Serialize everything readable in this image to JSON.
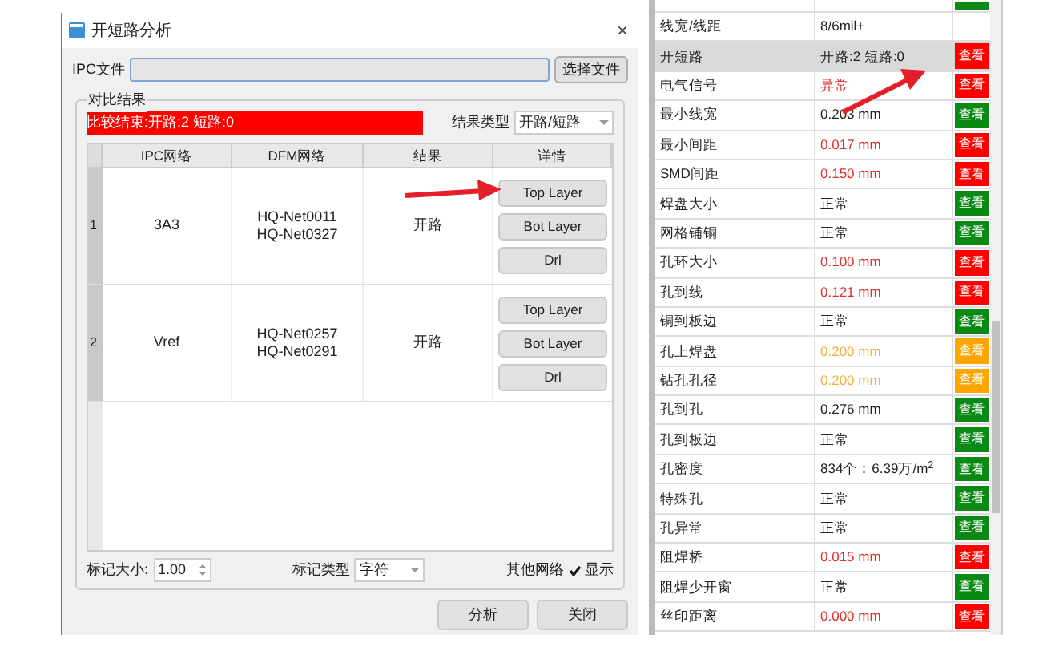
{
  "dialog": {
    "title": "开短路分析",
    "close": "×",
    "ipc_label": "IPC文件",
    "choose_button": "选择文件",
    "group_title": "对比结果",
    "summary": "比较结束:开路:2 短路:0",
    "result_type_label": "结果类型",
    "result_type_value": "开路/短路",
    "table": {
      "columns": [
        "IPC网络",
        "DFM网络",
        "结果",
        "详情"
      ],
      "rows": [
        {
          "index": "1",
          "ipc_net": "3A3",
          "dfm_nets": [
            "HQ-Net0011",
            "HQ-Net0327"
          ],
          "result": "开路",
          "buttons": [
            "Top Layer",
            "Bot Layer",
            "Drl"
          ]
        },
        {
          "index": "2",
          "ipc_net": "Vref",
          "dfm_nets": [
            "HQ-Net0257",
            "HQ-Net0291"
          ],
          "result": "开路",
          "buttons": [
            "Top Layer",
            "Bot Layer",
            "Drl"
          ]
        }
      ]
    },
    "mark_size_label": "标记大小:",
    "mark_size_value": "1.00",
    "mark_type_label": "标记类型",
    "mark_type_value": "字符",
    "other_nets_label": "其他网络",
    "show_label": "显示",
    "checked": true,
    "buttons": [
      "分析",
      "关闭"
    ]
  },
  "checks": [
    {
      "kind": "ok",
      "selected": false
    },
    {
      "label": "线宽/线距",
      "value": "8/6mil+",
      "alert": false,
      "warning": false,
      "kind": "plain",
      "selected": false
    },
    {
      "label": "开短路",
      "value": "开路:2 短路:0",
      "alert": false,
      "warning": false,
      "kind": "error",
      "button": "查看",
      "selected": true
    },
    {
      "label": "电气信号",
      "value": "异常",
      "alert": true,
      "warning": false,
      "kind": "error",
      "button": "查看",
      "selected": false
    },
    {
      "label": "最小线宽",
      "value": "0.203 mm",
      "alert": false,
      "warning": false,
      "kind": "ok",
      "button": "查看",
      "selected": false
    },
    {
      "label": "最小间距",
      "value": "0.017 mm",
      "alert": true,
      "warning": false,
      "kind": "error",
      "button": "查看",
      "selected": false
    },
    {
      "label": "SMD间距",
      "value": "0.150 mm",
      "alert": true,
      "warning": false,
      "kind": "error",
      "button": "查看",
      "selected": false
    },
    {
      "label": "焊盘大小",
      "value": "正常",
      "alert": false,
      "warning": false,
      "kind": "ok",
      "button": "查看",
      "selected": false
    },
    {
      "label": "网格铺铜",
      "value": "正常",
      "alert": false,
      "warning": false,
      "kind": "ok",
      "button": "查看",
      "selected": false
    },
    {
      "label": "孔环大小",
      "value": "0.100 mm",
      "alert": true,
      "warning": false,
      "kind": "error",
      "button": "查看",
      "selected": false
    },
    {
      "label": "孔到线",
      "value": "0.121 mm",
      "alert": true,
      "warning": false,
      "kind": "error",
      "button": "查看",
      "selected": false
    },
    {
      "label": "铜到板边",
      "value": "正常",
      "alert": false,
      "warning": false,
      "kind": "ok",
      "button": "查看",
      "selected": false
    },
    {
      "label": "孔上焊盘",
      "value": "0.200 mm",
      "alert": false,
      "warning": true,
      "kind": "warning",
      "button": "查看",
      "selected": false
    },
    {
      "label": "钻孔孔径",
      "value": "0.200 mm",
      "alert": false,
      "warning": true,
      "kind": "warning",
      "button": "查看",
      "selected": false
    },
    {
      "label": "孔到孔",
      "value": "0.276 mm",
      "alert": false,
      "warning": false,
      "kind": "ok",
      "button": "查看",
      "selected": false
    },
    {
      "label": "孔到板边",
      "value": "正常",
      "alert": false,
      "warning": false,
      "kind": "ok",
      "button": "查看",
      "selected": false
    },
    {
      "label": "孔密度",
      "value": "834个：6.39万/m$^{2}$",
      "alert": false,
      "warning": false,
      "kind": "ok",
      "button": "查看",
      "selected": false
    },
    {
      "label": "特殊孔",
      "value": "正常",
      "alert": false,
      "warning": false,
      "kind": "ok",
      "button": "查看",
      "selected": false
    },
    {
      "label": "孔异常",
      "value": "正常",
      "alert": false,
      "warning": false,
      "kind": "ok",
      "button": "查看",
      "selected": false
    },
    {
      "label": "阻焊桥",
      "value": "0.015 mm",
      "alert": true,
      "warning": false,
      "kind": "error",
      "button": "查看",
      "selected": false
    },
    {
      "label": "阻焊少开窗",
      "value": "正常",
      "alert": false,
      "warning": false,
      "kind": "ok",
      "button": "查看",
      "selected": false
    },
    {
      "label": "丝印距离",
      "value": "0.000 mm",
      "alert": true,
      "warning": false,
      "kind": "error",
      "button": "查看",
      "selected": false
    }
  ]
}
